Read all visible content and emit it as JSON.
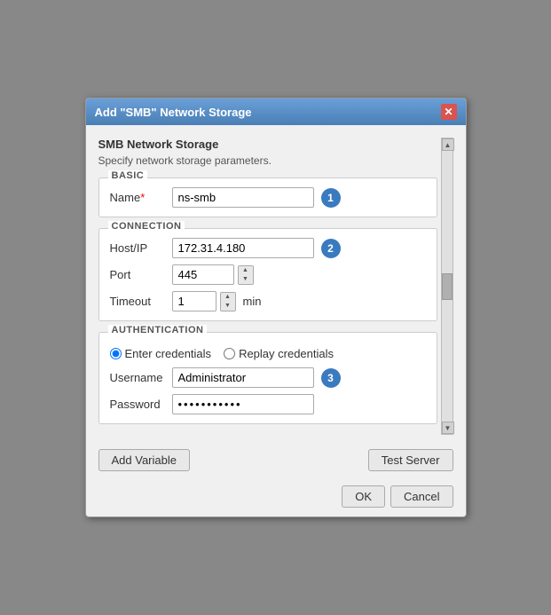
{
  "dialog": {
    "title": "Add \"SMB\" Network Storage",
    "close_label": "✕"
  },
  "section": {
    "heading": "SMB Network Storage",
    "subtitle": "Specify network storage parameters."
  },
  "basic": {
    "group_title": "BASIC",
    "name_label": "Name",
    "name_required": "*",
    "name_value": "ns-smb",
    "badge1": "1"
  },
  "connection": {
    "group_title": "CONNECTION",
    "host_label": "Host/IP",
    "host_value": "172.31.4.180",
    "badge2": "2",
    "port_label": "Port",
    "port_value": "445",
    "timeout_label": "Timeout",
    "timeout_value": "1",
    "timeout_unit": "min"
  },
  "authentication": {
    "group_title": "AUTHENTICATION",
    "radio1_label": "Enter credentials",
    "radio2_label": "Replay credentials",
    "username_label": "Username",
    "username_value": "Administrator",
    "badge3": "3",
    "password_label": "Password",
    "password_value": "••••••••••••"
  },
  "footer": {
    "add_variable_label": "Add Variable",
    "test_server_label": "Test Server",
    "ok_label": "OK",
    "cancel_label": "Cancel"
  }
}
